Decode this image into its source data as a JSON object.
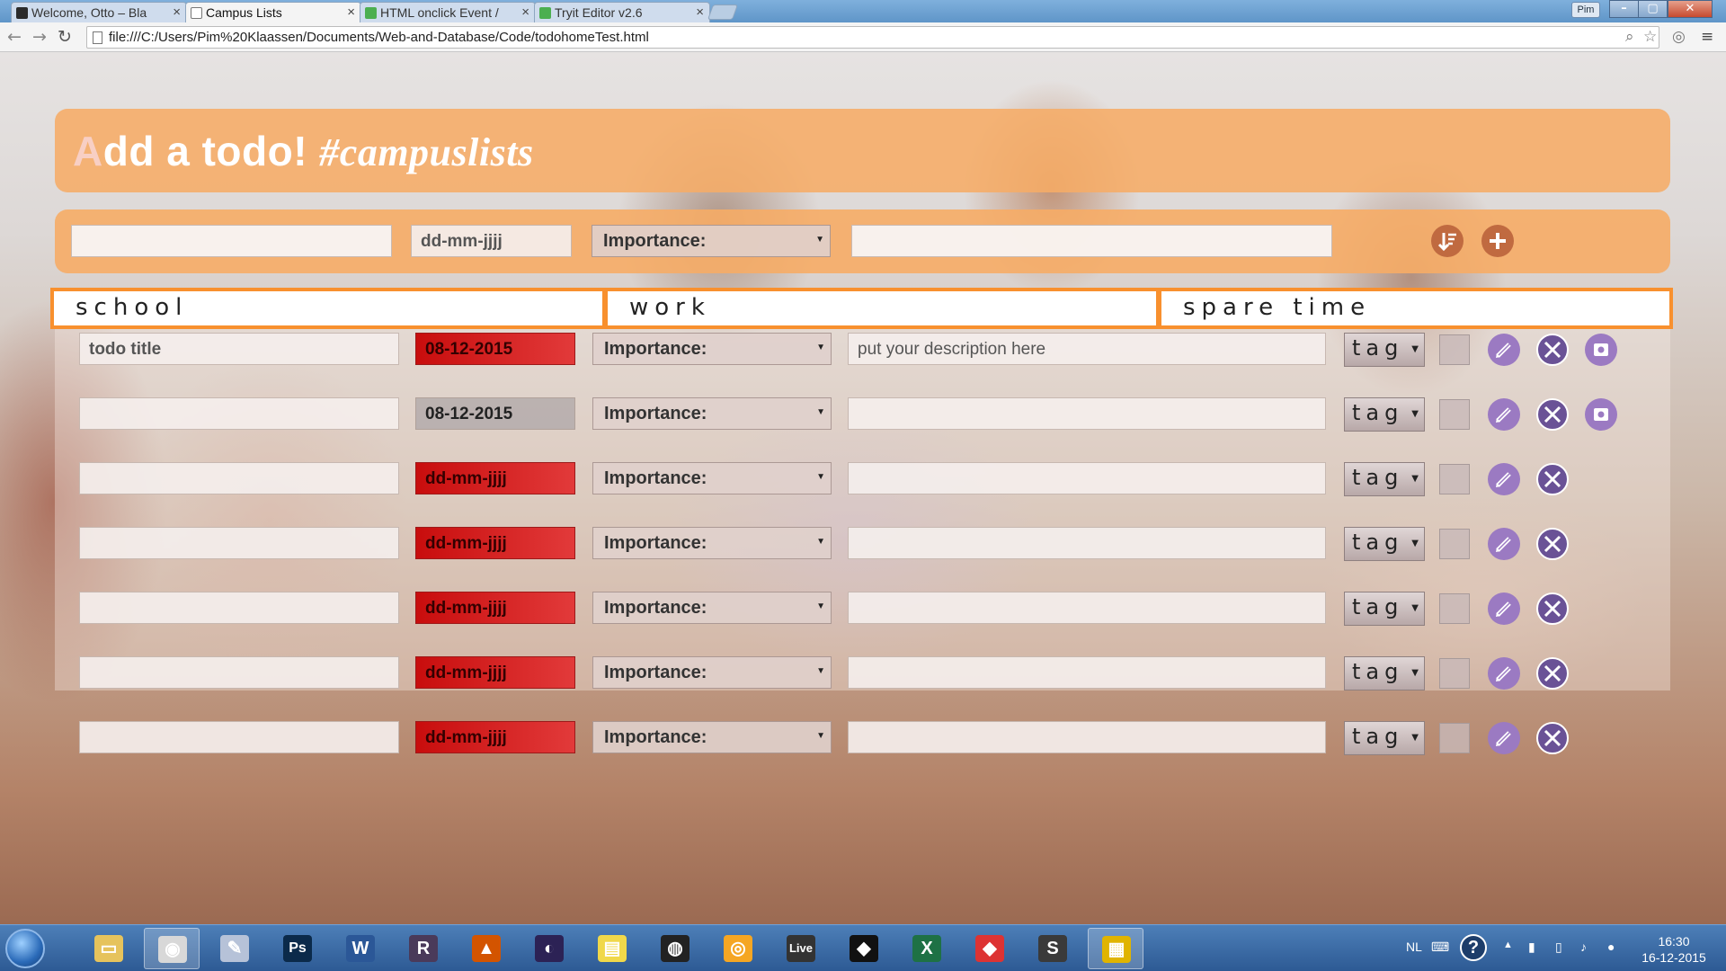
{
  "browser": {
    "tabs": [
      {
        "label": "Welcome, Otto – Bla",
        "active": false
      },
      {
        "label": "Campus Lists",
        "active": true
      },
      {
        "label": "HTML onclick Event /",
        "active": false
      },
      {
        "label": "Tryit Editor v2.6",
        "active": false
      }
    ],
    "user_badge": "Pim",
    "address": "file:///C:/Users/Pim%20Klaassen/Documents/Web-and-Database/Code/todohomeTest.html"
  },
  "app": {
    "title_first": "A",
    "title_rest": "dd a todo! ",
    "title_hash": "#campuslists",
    "add_form": {
      "title_value": "",
      "date_placeholder": "dd-mm-jjjj",
      "importance_label": "Importance:",
      "description_value": ""
    },
    "categories": [
      "school",
      "work",
      "spare time"
    ],
    "rows": [
      {
        "title": "todo title",
        "date": "08-12-2015",
        "date_style": "red",
        "importance": "Importance:",
        "description": "put your description here",
        "tag": "tag",
        "has_save": true
      },
      {
        "title": "",
        "date": "08-12-2015",
        "date_style": "grey",
        "importance": "Importance:",
        "description": "",
        "tag": "tag",
        "has_save": true
      },
      {
        "title": "",
        "date": "dd-mm-jjjj",
        "date_style": "red",
        "importance": "Importance:",
        "description": "",
        "tag": "tag",
        "has_save": false
      },
      {
        "title": "",
        "date": "dd-mm-jjjj",
        "date_style": "red",
        "importance": "Importance:",
        "description": "",
        "tag": "tag",
        "has_save": false
      },
      {
        "title": "",
        "date": "dd-mm-jjjj",
        "date_style": "red",
        "importance": "Importance:",
        "description": "",
        "tag": "tag",
        "has_save": false
      },
      {
        "title": "",
        "date": "dd-mm-jjjj",
        "date_style": "red",
        "importance": "Importance:",
        "description": "",
        "tag": "tag",
        "has_save": false
      },
      {
        "title": "",
        "date": "dd-mm-jjjj",
        "date_style": "red",
        "importance": "Importance:",
        "description": "",
        "tag": "tag",
        "has_save": false
      }
    ]
  },
  "taskbar": {
    "apps": [
      "Windows Explorer",
      "Google Chrome",
      "Paint",
      "Photoshop",
      "Word",
      "Razor",
      "MATLAB",
      "Eclipse",
      "Sticky Notes",
      "GitHub",
      "Blender",
      "Live",
      "Unity",
      "Excel",
      "Git Extensions",
      "Sublime Text",
      "Visual Paradigm"
    ],
    "live_label": "Live",
    "language": "NL",
    "time": "16:30",
    "date": "16-12-2015"
  },
  "colors": {
    "accent_orange": "#f6ac66",
    "tab_border_orange": "#f8902e",
    "date_red": "#c80d0d",
    "action_purple": "#9b7ac2",
    "delete_purple": "#6a5296"
  }
}
